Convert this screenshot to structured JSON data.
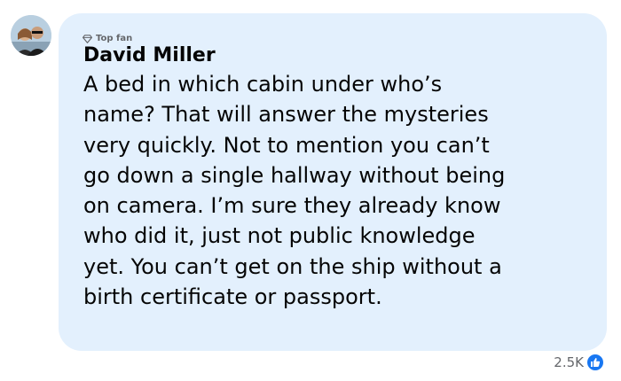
{
  "comment": {
    "badge_label": "Top fan",
    "author": "David Miller",
    "lines": [
      "A bed in which cabin under who’s",
      "name? That will answer the mysteries",
      "very quickly. Not to mention you can’t",
      "go down a single hallway without being",
      "on camera. I’m sure they already know",
      "who did it, just not public knowledge",
      "yet. You can’t get on the ship without a",
      "birth certificate or passport."
    ],
    "reaction_count": "2.5K",
    "reaction_icon": "like-icon",
    "colors": {
      "bubble": "#e3f0fd",
      "like": "#1877f2",
      "meta_text": "#65676b"
    }
  }
}
